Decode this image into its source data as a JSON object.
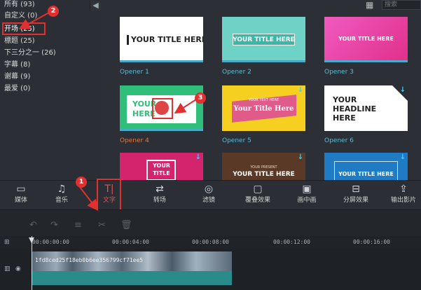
{
  "sidebar": {
    "collapse_icon": "chevron-left-icon",
    "items": [
      {
        "label": "所有 (93)"
      },
      {
        "label": "自定义 (0)"
      },
      {
        "label": "开场 (25)"
      },
      {
        "label": "標题 (25)"
      },
      {
        "label": "下三分之一 (26)"
      },
      {
        "label": "字幕 (8)"
      },
      {
        "label": "谢幕 (9)"
      },
      {
        "label": "最爱 (0)"
      }
    ]
  },
  "search": {
    "placeholder": "搜索"
  },
  "grid": {
    "items": [
      {
        "label": "Opener 1",
        "text": "YOUR TITLE HERE"
      },
      {
        "label": "Opener 2",
        "text": "YOUR TITLE HERE"
      },
      {
        "label": "Opener 3",
        "text": "YOUR TITLE HERE"
      },
      {
        "label": "Opener 4",
        "text_a": "YOUR",
        "text_b": "HERE"
      },
      {
        "label": "Opener 5",
        "text_small": "YOUR TEXT HERE",
        "text": "Your Title Here"
      },
      {
        "label": "Opener 6",
        "text": "YOUR HEADLINE HERE"
      },
      {
        "text_a": "YOUR",
        "text_b": "TITLE"
      },
      {
        "text_small": "YOUR PRESENT",
        "text": "YOUR TITLE HERE"
      },
      {
        "text": "YOUR TITLE HERE"
      }
    ]
  },
  "toolbar": {
    "items": [
      {
        "label": "媒体",
        "icon": "folder-icon"
      },
      {
        "label": "音乐",
        "icon": "music-note-icon"
      },
      {
        "label": "文字",
        "icon": "text-cursor-icon"
      },
      {
        "label": "转场",
        "icon": "transition-icon"
      },
      {
        "label": "滤镜",
        "icon": "filter-icon"
      },
      {
        "label": "覆叠效果",
        "icon": "overlay-icon"
      },
      {
        "label": "画中画",
        "icon": "picture-in-picture-icon"
      },
      {
        "label": "分屏效果",
        "icon": "split-screen-icon"
      },
      {
        "label": "输出影片",
        "icon": "export-icon"
      }
    ]
  },
  "timeline": {
    "ticks": [
      "00:00:00:00",
      "00:00:04:00",
      "00:00:08:00",
      "00:00:12:00",
      "00:00:16:00"
    ],
    "clip_name": "1fd8ced25f18eb0b6ee356799cf71ee5"
  },
  "annotations": {
    "one": "1",
    "two": "2",
    "three": "3"
  },
  "colors": {
    "accent": "#5fbcd3",
    "highlight": "#e03030",
    "clip": "#2a8c8a"
  }
}
